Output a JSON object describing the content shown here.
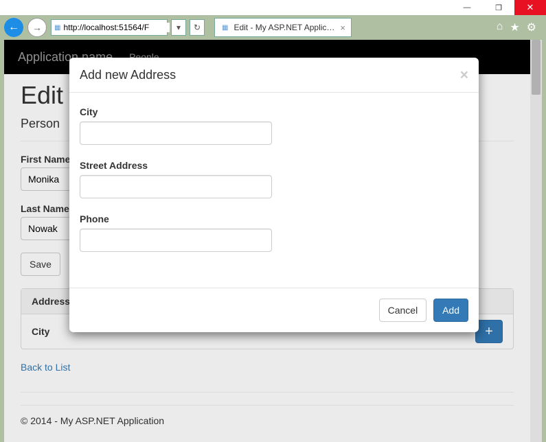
{
  "window": {
    "minimize": "—",
    "maximize": "❐",
    "close": "✕"
  },
  "browser": {
    "url": "http://localhost:51564/F",
    "tab_title": "Edit - My ASP.NET Applicat...",
    "tab_close": "×"
  },
  "nav": {
    "brand": "Application name",
    "link_people": "People"
  },
  "page": {
    "heading": "Edit",
    "subheading": "Person",
    "labels": {
      "first_name": "First Name",
      "last_name": "Last Name"
    },
    "values": {
      "first_name": "Monika",
      "last_name": "Nowak"
    },
    "save_button": "Save",
    "panel_title": "Addresses",
    "table_header_city": "City",
    "add_plus": "+",
    "back_link": "Back to List",
    "footer": "© 2014 - My ASP.NET Application"
  },
  "modal": {
    "title": "Add new Address",
    "close": "×",
    "fields": {
      "city": "City",
      "street": "Street Address",
      "phone": "Phone"
    },
    "values": {
      "city": "",
      "street": "",
      "phone": ""
    },
    "cancel": "Cancel",
    "add": "Add"
  }
}
